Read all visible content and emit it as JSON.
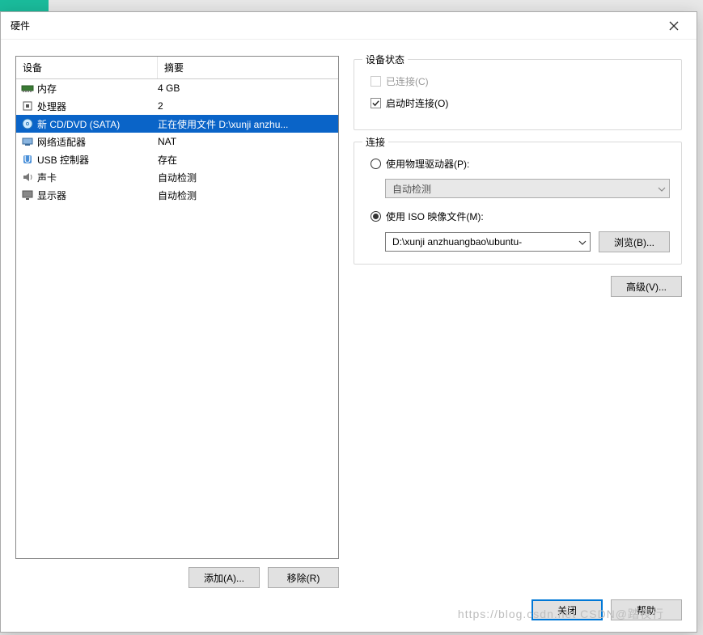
{
  "dialog": {
    "title": "硬件",
    "columns": {
      "device": "设备",
      "summary": "摘要"
    },
    "devices": [
      {
        "icon": "memory-icon",
        "name": "内存",
        "summary": "4 GB",
        "selected": false
      },
      {
        "icon": "cpu-icon",
        "name": "处理器",
        "summary": "2",
        "selected": false
      },
      {
        "icon": "cd-icon",
        "name": "新 CD/DVD (SATA)",
        "summary": "正在使用文件 D:\\xunji anzhu...",
        "selected": true
      },
      {
        "icon": "nic-icon",
        "name": "网络适配器",
        "summary": "NAT",
        "selected": false
      },
      {
        "icon": "usb-icon",
        "name": "USB 控制器",
        "summary": "存在",
        "selected": false
      },
      {
        "icon": "sound-icon",
        "name": "声卡",
        "summary": "自动检测",
        "selected": false
      },
      {
        "icon": "monitor-icon",
        "name": "显示器",
        "summary": "自动检测",
        "selected": false
      }
    ],
    "buttons": {
      "add": "添加(A)...",
      "remove": "移除(R)",
      "close": "关闭",
      "help": "帮助"
    }
  },
  "status": {
    "legend": "设备状态",
    "connected": {
      "label": "已连接(C)",
      "checked": false,
      "enabled": false
    },
    "connect_on_power": {
      "label": "启动时连接(O)",
      "checked": true,
      "enabled": true
    }
  },
  "connection": {
    "legend": "连接",
    "physical": {
      "label": "使用物理驱动器(P):",
      "selected": false,
      "dropdown_value": "自动检测"
    },
    "iso": {
      "label": "使用 ISO 映像文件(M):",
      "selected": true,
      "path": "D:\\xunji anzhuangbao\\ubuntu-",
      "browse": "浏览(B)..."
    },
    "advanced": "高级(V)..."
  },
  "watermark": "https://blog.csdn.net CSDN@踏夜行"
}
